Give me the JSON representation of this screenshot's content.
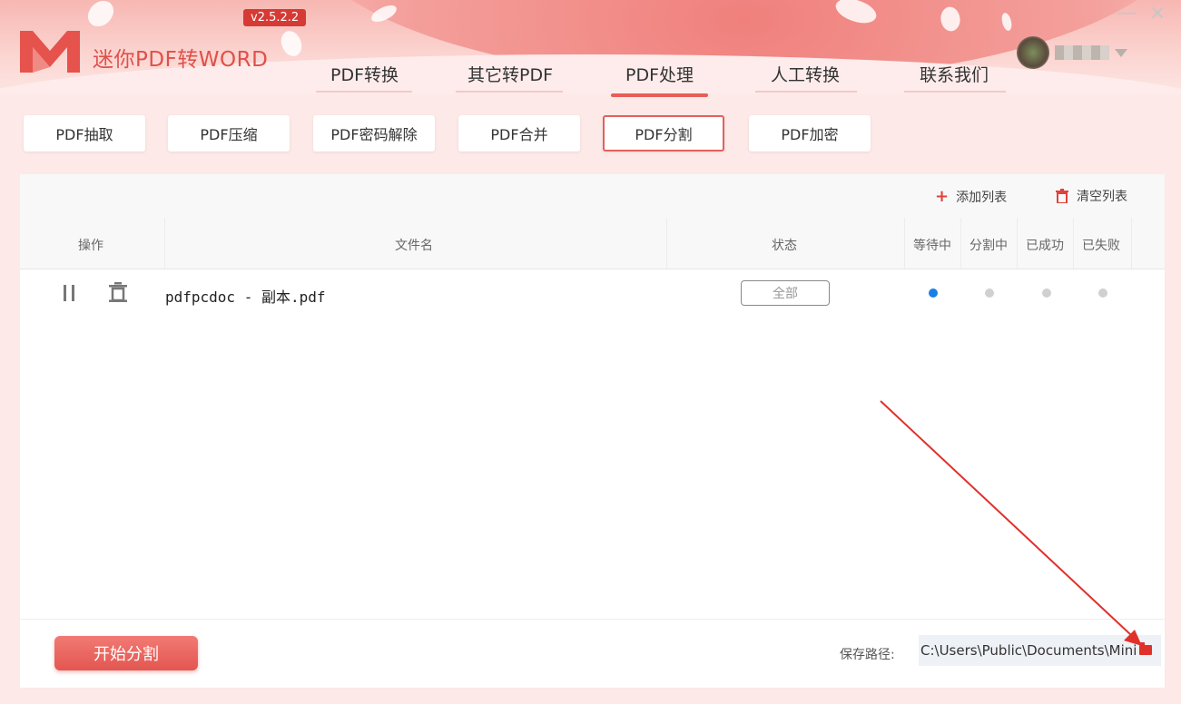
{
  "app": {
    "title": "迷你PDF转WORD",
    "version": "v2.5.2.2"
  },
  "window": {
    "minimize": "—",
    "close": "×"
  },
  "nav": {
    "items": [
      "PDF转换",
      "其它转PDF",
      "PDF处理",
      "人工转换",
      "联系我们"
    ],
    "active_index": 2
  },
  "subtabs": {
    "items": [
      "PDF抽取",
      "PDF压缩",
      "PDF密码解除",
      "PDF合并",
      "PDF分割",
      "PDF加密"
    ],
    "active_index": 4
  },
  "toolbar": {
    "add_label": "添加列表",
    "add_icon": "plus-icon",
    "clear_label": "清空列表",
    "clear_icon": "trash-icon"
  },
  "table": {
    "headers": {
      "action": "操作",
      "filename": "文件名",
      "status": "状态",
      "waiting": "等待中",
      "splitting": "分割中",
      "success": "已成功",
      "failed": "已失败"
    },
    "rows": [
      {
        "filename": "pdfpcdoc - 副本.pdf",
        "status_button": "全部",
        "stage": "waiting"
      }
    ]
  },
  "footer": {
    "start_label": "开始分割",
    "save_label": "保存路径:",
    "save_path": "C:\\Users\\Public\\Documents\\Mini"
  },
  "colors": {
    "accent": "#e85d57",
    "active_dot": "#1a7fe5",
    "inactive_dot": "#d0d0d0",
    "annotation": "#e0302a"
  }
}
